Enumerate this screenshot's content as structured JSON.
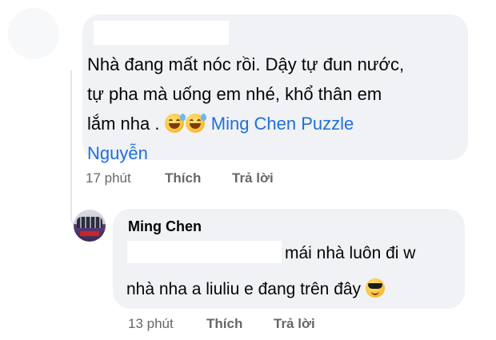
{
  "comment": {
    "text_line1": "Nhà đang mất nóc rồi. Dậy tự đun nước,",
    "text_line2": "tự pha mà uống em nhé, khổ thân em",
    "text_line3": "lắm nha .",
    "emoji_1": "sweat-smile-emoji-icon",
    "emoji_2": "sweat-smile-emoji-icon",
    "mention_part1": "Ming Chen Puzzle",
    "mention_part2": "Nguyễn",
    "time": "17 phút",
    "like_label": "Thích",
    "reply_label": "Trả lời"
  },
  "reply": {
    "author": "Ming Chen",
    "line1": "mái nhà luôn đi w",
    "line2": "nhà nha a liuliu e đang trên đây",
    "emoji": "sunglasses-emoji-icon",
    "time": "13 phút",
    "like_label": "Thích",
    "reply_label": "Trả lời"
  },
  "colors": {
    "bubble": "#f0f2f5",
    "mention": "#216fdb",
    "meta_text": "#65676b",
    "thread_line": "#e4e6eb"
  }
}
